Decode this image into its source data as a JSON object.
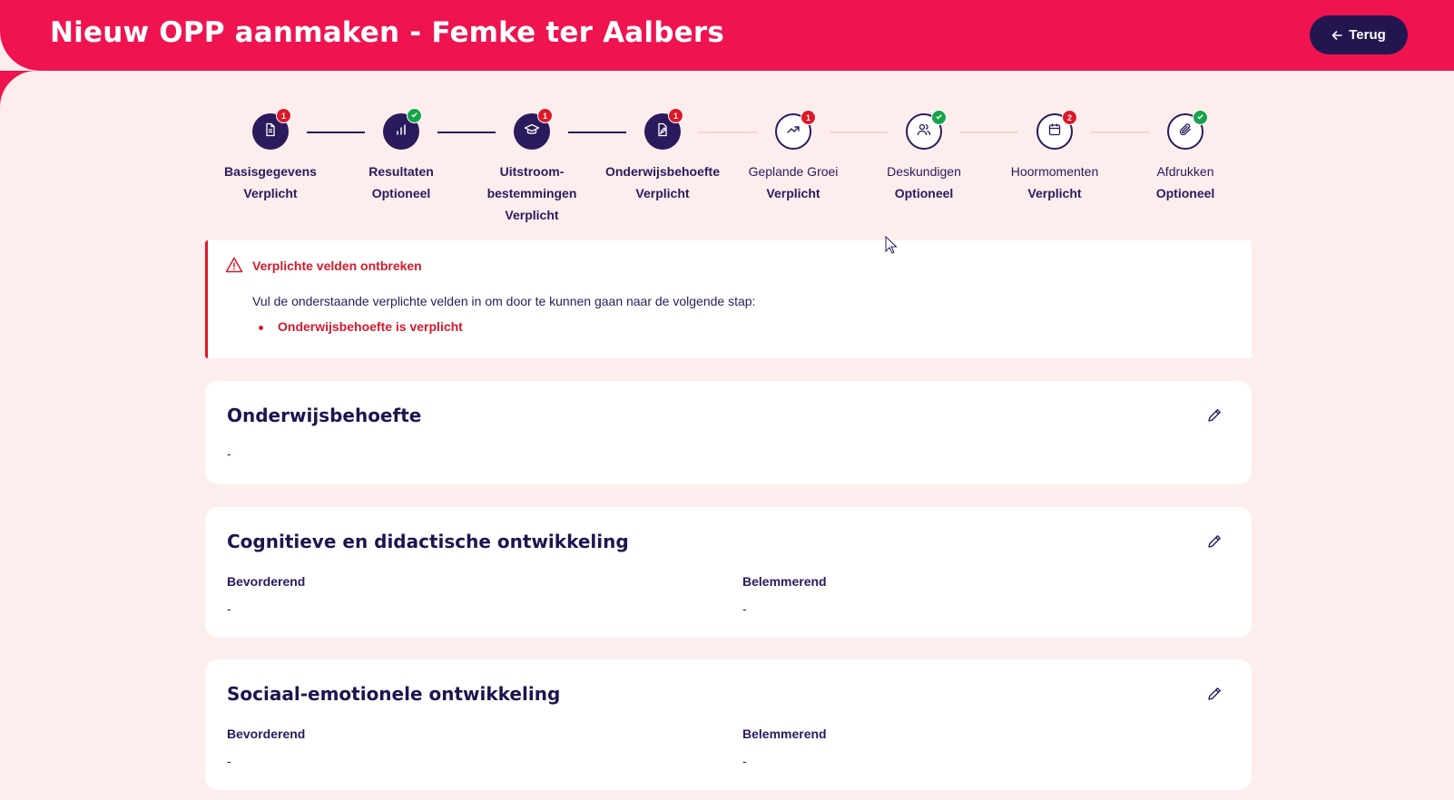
{
  "header": {
    "title": "Nieuw OPP aanmaken - Femke ter Aalbers",
    "back_label": "Terug"
  },
  "colors": {
    "brand": "#ef134f",
    "primary": "#2b1a5c",
    "error": "#e01727",
    "success": "#17a34a",
    "background": "#fdeeed"
  },
  "steps": [
    {
      "name": "Basisgegevens",
      "requirement": "Verplicht",
      "icon": "document-icon",
      "status": "error",
      "badge": "1",
      "state": "completed"
    },
    {
      "name": "Resultaten",
      "requirement": "Optioneel",
      "icon": "bar-chart-icon",
      "status": "ok",
      "badge": "",
      "state": "completed"
    },
    {
      "name": "Uitstroom-",
      "name2": "bestemmingen",
      "requirement": "Verplicht",
      "icon": "graduation-cap-icon",
      "status": "error",
      "badge": "1",
      "state": "completed"
    },
    {
      "name": "Onderwijsbehoefte",
      "requirement": "Verplicht",
      "icon": "file-edit-icon",
      "status": "error",
      "badge": "1",
      "state": "current"
    },
    {
      "name": "Geplande Groei",
      "requirement": "Verplicht",
      "icon": "trending-up-icon",
      "status": "error",
      "badge": "1",
      "state": "upcoming"
    },
    {
      "name": "Deskundigen",
      "requirement": "Optioneel",
      "icon": "users-icon",
      "status": "ok",
      "badge": "",
      "state": "upcoming"
    },
    {
      "name": "Hoormomenten",
      "requirement": "Verplicht",
      "icon": "calendar-icon",
      "status": "error",
      "badge": "2",
      "state": "upcoming"
    },
    {
      "name": "Afdrukken",
      "requirement": "Optioneel",
      "icon": "paperclip-icon",
      "status": "ok",
      "badge": "",
      "state": "upcoming"
    }
  ],
  "alert": {
    "title": "Verplichte velden ontbreken",
    "text": "Vul de onderstaande verplichte velden in om door te kunnen gaan naar de volgende stap:",
    "items": [
      "Onderwijsbehoefte is verplicht"
    ]
  },
  "cards": [
    {
      "title": "Onderwijsbehoefte",
      "value": "-"
    },
    {
      "title": "Cognitieve en didactische ontwikkeling",
      "left_label": "Bevorderend",
      "left_value": "-",
      "right_label": "Belemmerend",
      "right_value": "-"
    },
    {
      "title": "Sociaal-emotionele ontwikkeling",
      "left_label": "Bevorderend",
      "left_value": "-",
      "right_label": "Belemmerend",
      "right_value": "-"
    }
  ]
}
